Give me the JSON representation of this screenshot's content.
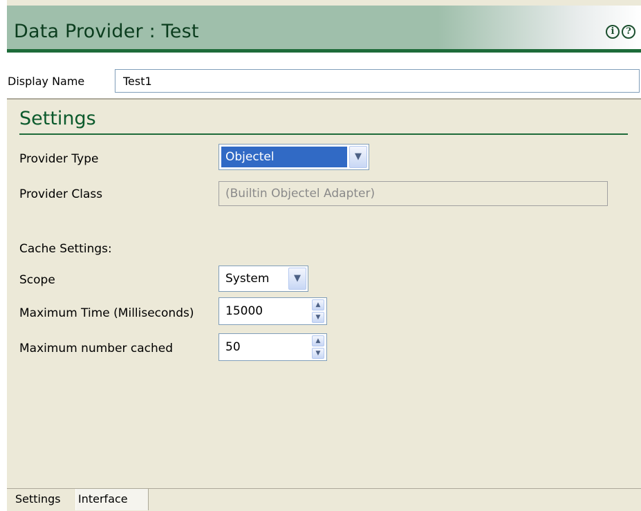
{
  "header": {
    "title": "Data Provider : Test",
    "info_icon": "info-icon",
    "help_icon": "help-icon",
    "info_glyph": "i",
    "help_glyph": "?"
  },
  "display_name": {
    "label": "Display Name",
    "value": "Test1"
  },
  "settings": {
    "section_title": "Settings",
    "provider_type": {
      "label": "Provider Type",
      "selected": "Objectel"
    },
    "provider_class": {
      "label": "Provider Class",
      "value": "(Builtin Objectel Adapter)"
    },
    "cache_settings_label": "Cache Settings:",
    "scope": {
      "label": "Scope",
      "selected": "System"
    },
    "max_time": {
      "label": "Maximum Time (Milliseconds)",
      "value": "15000"
    },
    "max_cached": {
      "label": "Maximum number cached",
      "value": "50"
    }
  },
  "tabs": [
    {
      "label": "Settings",
      "active": true
    },
    {
      "label": "Interface",
      "active": false
    }
  ],
  "colors": {
    "header_bg": "#9fbfab",
    "accent_green": "#1d6b39",
    "title_text": "#0b3d1e",
    "selection_blue": "#316ac5",
    "panel_bg": "#ece9d8"
  },
  "glyphs": {
    "dropdown_arrow": "▼",
    "spin_up": "▲",
    "spin_down": "▼"
  }
}
